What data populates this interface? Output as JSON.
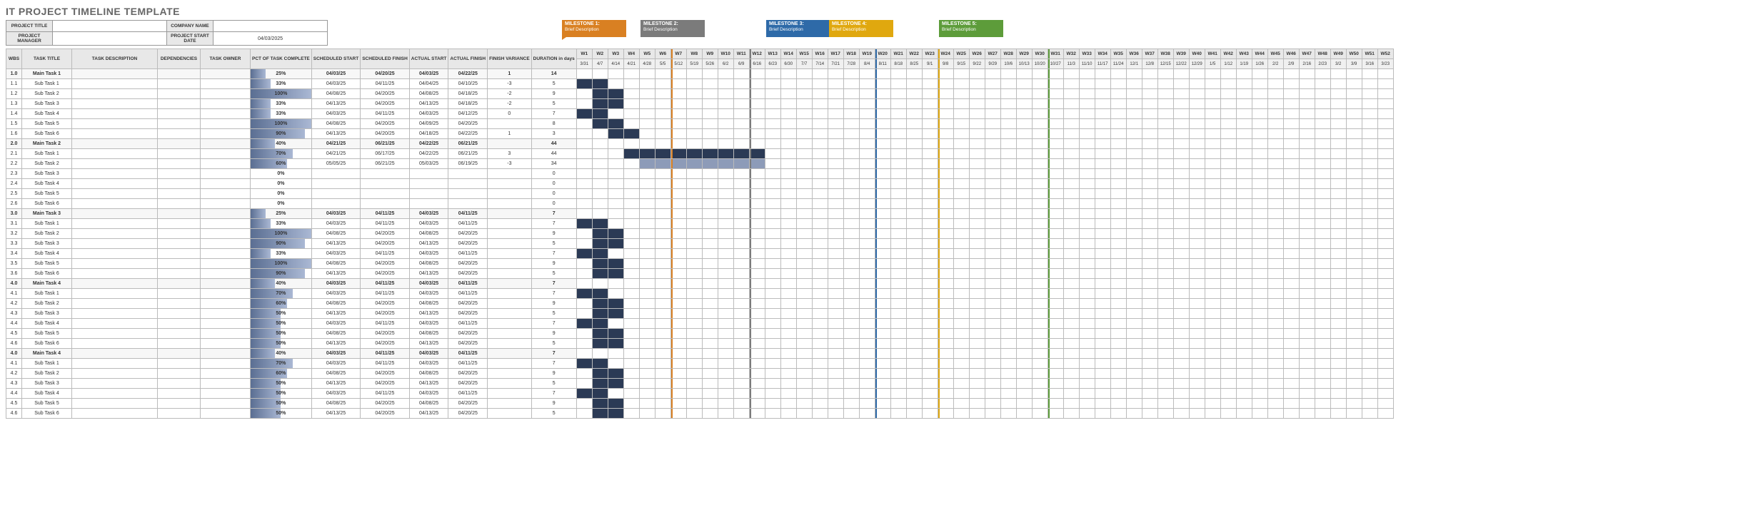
{
  "title": "IT PROJECT TIMELINE TEMPLATE",
  "header": {
    "project_title_lbl": "PROJECT TITLE",
    "company_name_lbl": "COMPANY NAME",
    "project_manager_lbl": "PROJECT MANAGER",
    "project_start_lbl": "PROJECT START DATE",
    "project_title": "",
    "company_name": "",
    "project_manager": "",
    "project_start": "04/03/2025"
  },
  "milestones": [
    {
      "id": 1,
      "name": "MILESTONE 1:",
      "desc": "Brief Description",
      "week": 7,
      "color": "ms1"
    },
    {
      "id": 2,
      "name": "MILESTONE 2:",
      "desc": "Brief Description",
      "week": 12,
      "color": "ms2"
    },
    {
      "id": 3,
      "name": "MILESTONE 3:",
      "desc": "Brief Description",
      "week": 20,
      "color": "ms3"
    },
    {
      "id": 4,
      "name": "MILESTONE 4:",
      "desc": "Brief Description",
      "week": 24,
      "color": "ms4"
    },
    {
      "id": 5,
      "name": "MILESTONE 5:",
      "desc": "Brief Description",
      "week": 31,
      "color": "ms5"
    }
  ],
  "cols": {
    "wbs": "WBS",
    "task_title": "TASK TITLE",
    "task_desc": "TASK DESCRIPTION",
    "deps": "DEPENDENCIES",
    "owner": "TASK OWNER",
    "pct": "PCT OF TASK COMPLETE",
    "ss": "SCHEDULED START",
    "sf": "SCHEDULED FINISH",
    "as": "ACTUAL START",
    "af": "ACTUAL FINISH",
    "fv": "FINISH VARIANCE",
    "dur": "DURATION in days"
  },
  "weeks": [
    {
      "w": "W1",
      "d": "3/31"
    },
    {
      "w": "W2",
      "d": "4/7"
    },
    {
      "w": "W3",
      "d": "4/14"
    },
    {
      "w": "W4",
      "d": "4/21"
    },
    {
      "w": "W5",
      "d": "4/28"
    },
    {
      "w": "W6",
      "d": "5/5"
    },
    {
      "w": "W7",
      "d": "5/12"
    },
    {
      "w": "W8",
      "d": "5/19"
    },
    {
      "w": "W9",
      "d": "5/26"
    },
    {
      "w": "W10",
      "d": "6/2"
    },
    {
      "w": "W11",
      "d": "6/9"
    },
    {
      "w": "W12",
      "d": "6/16"
    },
    {
      "w": "W13",
      "d": "6/23"
    },
    {
      "w": "W14",
      "d": "6/30"
    },
    {
      "w": "W15",
      "d": "7/7"
    },
    {
      "w": "W16",
      "d": "7/14"
    },
    {
      "w": "W17",
      "d": "7/21"
    },
    {
      "w": "W18",
      "d": "7/28"
    },
    {
      "w": "W19",
      "d": "8/4"
    },
    {
      "w": "W20",
      "d": "8/11"
    },
    {
      "w": "W21",
      "d": "8/18"
    },
    {
      "w": "W22",
      "d": "8/25"
    },
    {
      "w": "W23",
      "d": "9/1"
    },
    {
      "w": "W24",
      "d": "9/8"
    },
    {
      "w": "W25",
      "d": "9/15"
    },
    {
      "w": "W26",
      "d": "9/22"
    },
    {
      "w": "W27",
      "d": "9/29"
    },
    {
      "w": "W28",
      "d": "10/6"
    },
    {
      "w": "W29",
      "d": "10/13"
    },
    {
      "w": "W30",
      "d": "10/20"
    },
    {
      "w": "W31",
      "d": "10/27"
    },
    {
      "w": "W32",
      "d": "11/3"
    },
    {
      "w": "W33",
      "d": "11/10"
    },
    {
      "w": "W34",
      "d": "11/17"
    },
    {
      "w": "W35",
      "d": "11/24"
    },
    {
      "w": "W36",
      "d": "12/1"
    },
    {
      "w": "W37",
      "d": "12/8"
    },
    {
      "w": "W38",
      "d": "12/15"
    },
    {
      "w": "W39",
      "d": "12/22"
    },
    {
      "w": "W40",
      "d": "12/29"
    },
    {
      "w": "W41",
      "d": "1/5"
    },
    {
      "w": "W42",
      "d": "1/12"
    },
    {
      "w": "W43",
      "d": "1/19"
    },
    {
      "w": "W44",
      "d": "1/26"
    },
    {
      "w": "W45",
      "d": "2/2"
    },
    {
      "w": "W46",
      "d": "2/9"
    },
    {
      "w": "W47",
      "d": "2/16"
    },
    {
      "w": "W48",
      "d": "2/23"
    },
    {
      "w": "W49",
      "d": "3/2"
    },
    {
      "w": "W50",
      "d": "3/9"
    },
    {
      "w": "W51",
      "d": "3/16"
    },
    {
      "w": "W52",
      "d": "3/23"
    }
  ],
  "rows": [
    {
      "wbs": "1.0",
      "t": "Main Task 1",
      "main": true,
      "pct": 25,
      "ss": "04/03/25",
      "sf": "04/20/25",
      "as": "04/03/25",
      "af": "04/22/25",
      "fv": "1",
      "dur": "14",
      "gs": 1,
      "ge": 3
    },
    {
      "wbs": "1.1",
      "t": "Sub Task 1",
      "pct": 33,
      "ss": "04/03/25",
      "sf": "04/11/25",
      "as": "04/04/25",
      "af": "04/10/25",
      "fv": "-3",
      "dur": "5",
      "gs": 1,
      "ge": 2
    },
    {
      "wbs": "1.2",
      "t": "Sub Task 2",
      "pct": 100,
      "ss": "04/08/25",
      "sf": "04/20/25",
      "as": "04/08/25",
      "af": "04/18/25",
      "fv": "-2",
      "dur": "9",
      "gs": 2,
      "ge": 3
    },
    {
      "wbs": "1.3",
      "t": "Sub Task 3",
      "pct": 33,
      "ss": "04/13/25",
      "sf": "04/20/25",
      "as": "04/13/25",
      "af": "04/18/25",
      "fv": "-2",
      "dur": "5",
      "gs": 2,
      "ge": 3
    },
    {
      "wbs": "1.4",
      "t": "Sub Task 4",
      "pct": 33,
      "ss": "04/03/25",
      "sf": "04/11/25",
      "as": "04/03/25",
      "af": "04/12/25",
      "fv": "0",
      "dur": "7",
      "gs": 1,
      "ge": 2
    },
    {
      "wbs": "1.5",
      "t": "Sub Task 5",
      "pct": 100,
      "ss": "04/08/25",
      "sf": "04/20/25",
      "as": "04/09/25",
      "af": "04/20/25",
      "fv": "",
      "dur": "8",
      "gs": 2,
      "ge": 3
    },
    {
      "wbs": "1.6",
      "t": "Sub Task 6",
      "pct": 90,
      "ss": "04/13/25",
      "sf": "04/20/25",
      "as": "04/18/25",
      "af": "04/22/25",
      "fv": "1",
      "dur": "3",
      "gs": 3,
      "ge": 4
    },
    {
      "wbs": "2.0",
      "t": "Main Task 2",
      "main": true,
      "pct": 40,
      "ss": "04/21/25",
      "sf": "06/21/25",
      "as": "04/22/25",
      "af": "06/21/25",
      "fv": "",
      "dur": "44",
      "gs": 4,
      "ge": 12
    },
    {
      "wbs": "2.1",
      "t": "Sub Task 1",
      "pct": 70,
      "ss": "04/21/25",
      "sf": "06/17/25",
      "as": "04/22/25",
      "af": "06/21/25",
      "fv": "3",
      "dur": "44",
      "gs": 4,
      "ge": 12
    },
    {
      "wbs": "2.2",
      "t": "Sub Task 2",
      "pct": 60,
      "ss": "05/05/25",
      "sf": "06/21/25",
      "as": "05/03/25",
      "af": "06/19/25",
      "fv": "-3",
      "dur": "34",
      "gs": 5,
      "ge": 12,
      "alt": true
    },
    {
      "wbs": "2.3",
      "t": "Sub Task 3",
      "pct": 0,
      "dur": "0"
    },
    {
      "wbs": "2.4",
      "t": "Sub Task 4",
      "pct": 0,
      "dur": "0"
    },
    {
      "wbs": "2.5",
      "t": "Sub Task 5",
      "pct": 0,
      "dur": "0"
    },
    {
      "wbs": "2.6",
      "t": "Sub Task 6",
      "pct": 0,
      "dur": "0"
    },
    {
      "wbs": "3.0",
      "t": "Main Task 3",
      "main": true,
      "pct": 25,
      "ss": "04/03/25",
      "sf": "04/11/25",
      "as": "04/03/25",
      "af": "04/11/25",
      "fv": "",
      "dur": "7",
      "gs": 1,
      "ge": 2
    },
    {
      "wbs": "3.1",
      "t": "Sub Task 1",
      "pct": 33,
      "ss": "04/03/25",
      "sf": "04/11/25",
      "as": "04/03/25",
      "af": "04/11/25",
      "fv": "",
      "dur": "7",
      "gs": 1,
      "ge": 2
    },
    {
      "wbs": "3.2",
      "t": "Sub Task 2",
      "pct": 100,
      "ss": "04/08/25",
      "sf": "04/20/25",
      "as": "04/08/25",
      "af": "04/20/25",
      "fv": "",
      "dur": "9",
      "gs": 2,
      "ge": 3
    },
    {
      "wbs": "3.3",
      "t": "Sub Task 3",
      "pct": 90,
      "ss": "04/13/25",
      "sf": "04/20/25",
      "as": "04/13/25",
      "af": "04/20/25",
      "fv": "",
      "dur": "5",
      "gs": 2,
      "ge": 3
    },
    {
      "wbs": "3.4",
      "t": "Sub Task 4",
      "pct": 33,
      "ss": "04/03/25",
      "sf": "04/11/25",
      "as": "04/03/25",
      "af": "04/11/25",
      "fv": "",
      "dur": "7",
      "gs": 1,
      "ge": 2
    },
    {
      "wbs": "3.5",
      "t": "Sub Task 5",
      "pct": 100,
      "ss": "04/08/25",
      "sf": "04/20/25",
      "as": "04/08/25",
      "af": "04/20/25",
      "fv": "",
      "dur": "9",
      "gs": 2,
      "ge": 3
    },
    {
      "wbs": "3.6",
      "t": "Sub Task 6",
      "pct": 90,
      "ss": "04/13/25",
      "sf": "04/20/25",
      "as": "04/13/25",
      "af": "04/20/25",
      "fv": "",
      "dur": "5",
      "gs": 2,
      "ge": 3
    },
    {
      "wbs": "4.0",
      "t": "Main Task 4",
      "main": true,
      "pct": 40,
      "ss": "04/03/25",
      "sf": "04/11/25",
      "as": "04/03/25",
      "af": "04/11/25",
      "fv": "",
      "dur": "7",
      "gs": 1,
      "ge": 2
    },
    {
      "wbs": "4.1",
      "t": "Sub Task 1",
      "pct": 70,
      "ss": "04/03/25",
      "sf": "04/11/25",
      "as": "04/03/25",
      "af": "04/11/25",
      "fv": "",
      "dur": "7",
      "gs": 1,
      "ge": 2
    },
    {
      "wbs": "4.2",
      "t": "Sub Task 2",
      "pct": 60,
      "ss": "04/08/25",
      "sf": "04/20/25",
      "as": "04/08/25",
      "af": "04/20/25",
      "fv": "",
      "dur": "9",
      "gs": 2,
      "ge": 3
    },
    {
      "wbs": "4.3",
      "t": "Sub Task 3",
      "pct": 50,
      "ss": "04/13/25",
      "sf": "04/20/25",
      "as": "04/13/25",
      "af": "04/20/25",
      "fv": "",
      "dur": "5",
      "gs": 2,
      "ge": 3
    },
    {
      "wbs": "4.4",
      "t": "Sub Task 4",
      "pct": 50,
      "ss": "04/03/25",
      "sf": "04/11/25",
      "as": "04/03/25",
      "af": "04/11/25",
      "fv": "",
      "dur": "7",
      "gs": 1,
      "ge": 2
    },
    {
      "wbs": "4.5",
      "t": "Sub Task 5",
      "pct": 50,
      "ss": "04/08/25",
      "sf": "04/20/25",
      "as": "04/08/25",
      "af": "04/20/25",
      "fv": "",
      "dur": "9",
      "gs": 2,
      "ge": 3
    },
    {
      "wbs": "4.6",
      "t": "Sub Task 6",
      "pct": 50,
      "ss": "04/13/25",
      "sf": "04/20/25",
      "as": "04/13/25",
      "af": "04/20/25",
      "fv": "",
      "dur": "5",
      "gs": 2,
      "ge": 3
    },
    {
      "wbs": "4.0",
      "t": "Main Task 4",
      "main": true,
      "pct": 40,
      "ss": "04/03/25",
      "sf": "04/11/25",
      "as": "04/03/25",
      "af": "04/11/25",
      "fv": "",
      "dur": "7",
      "gs": 1,
      "ge": 2
    },
    {
      "wbs": "4.1",
      "t": "Sub Task 1",
      "pct": 70,
      "ss": "04/03/25",
      "sf": "04/11/25",
      "as": "04/03/25",
      "af": "04/11/25",
      "fv": "",
      "dur": "7",
      "gs": 1,
      "ge": 2
    },
    {
      "wbs": "4.2",
      "t": "Sub Task 2",
      "pct": 60,
      "ss": "04/08/25",
      "sf": "04/20/25",
      "as": "04/08/25",
      "af": "04/20/25",
      "fv": "",
      "dur": "9",
      "gs": 2,
      "ge": 3
    },
    {
      "wbs": "4.3",
      "t": "Sub Task 3",
      "pct": 50,
      "ss": "04/13/25",
      "sf": "04/20/25",
      "as": "04/13/25",
      "af": "04/20/25",
      "fv": "",
      "dur": "5",
      "gs": 2,
      "ge": 3
    },
    {
      "wbs": "4.4",
      "t": "Sub Task 4",
      "pct": 50,
      "ss": "04/03/25",
      "sf": "04/11/25",
      "as": "04/03/25",
      "af": "04/11/25",
      "fv": "",
      "dur": "7",
      "gs": 1,
      "ge": 2
    },
    {
      "wbs": "4.5",
      "t": "Sub Task 5",
      "pct": 50,
      "ss": "04/08/25",
      "sf": "04/20/25",
      "as": "04/08/25",
      "af": "04/20/25",
      "fv": "",
      "dur": "9",
      "gs": 2,
      "ge": 3
    },
    {
      "wbs": "4.6",
      "t": "Sub Task 6",
      "pct": 50,
      "ss": "04/13/25",
      "sf": "04/20/25",
      "as": "04/13/25",
      "af": "04/20/25",
      "fv": "",
      "dur": "5",
      "gs": 2,
      "ge": 3
    }
  ]
}
